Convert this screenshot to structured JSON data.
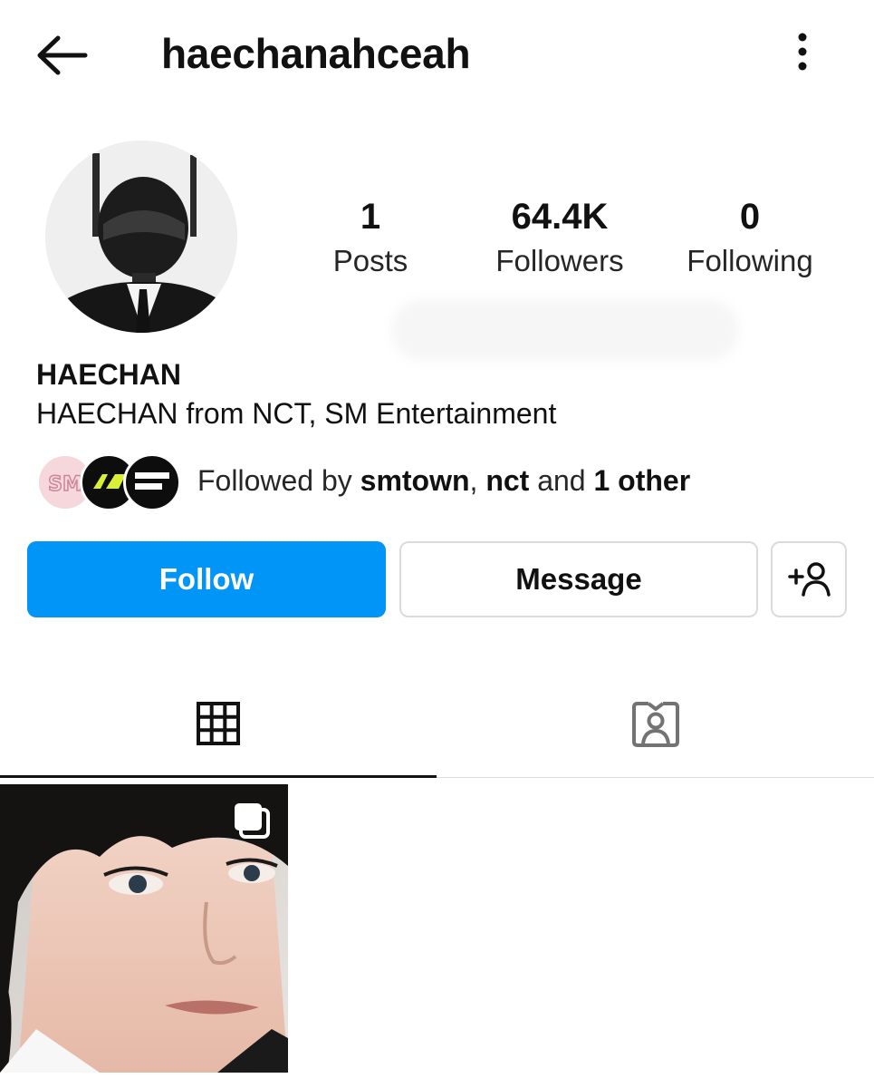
{
  "header": {
    "username": "haechanahceah",
    "back_icon": "arrow-left-icon",
    "more_icon": "more-vertical-icon"
  },
  "profile": {
    "display_name": "HAECHAN",
    "bio": "HAECHAN from NCT, SM Entertainment"
  },
  "stats": {
    "posts": {
      "value": "1",
      "label": "Posts"
    },
    "followers": {
      "value": "64.4K",
      "label": "Followers"
    },
    "following": {
      "value": "0",
      "label": "Following"
    }
  },
  "followed_by": {
    "prefix": "Followed by",
    "user1": "smtown",
    "sep": ",",
    "user2": "nct",
    "conj": "and",
    "others": "1 other"
  },
  "mutual_avatars": [
    "smtown",
    "nct",
    "nct-dream"
  ],
  "actions": {
    "follow_label": "Follow",
    "message_label": "Message",
    "suggest_icon": "add-person-icon"
  },
  "tabs": [
    {
      "name": "posts-grid",
      "icon": "grid-icon",
      "active": true
    },
    {
      "name": "tagged",
      "icon": "tagged-person-icon",
      "active": false
    }
  ],
  "colors": {
    "follow_button": "#0095f6",
    "text_primary": "#111111",
    "border": "#dbdbdb"
  }
}
